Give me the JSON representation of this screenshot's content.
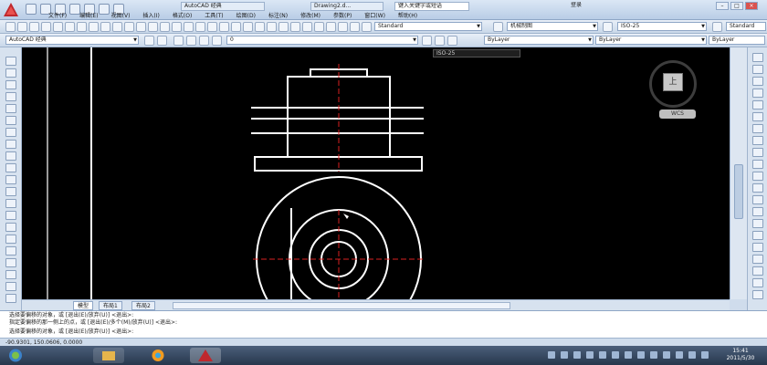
{
  "titlebar": {
    "workspace": "AutoCAD 经典",
    "document": "Drawing2.d...",
    "search_placeholder": "键入关键字或短语",
    "login": "登录"
  },
  "menu": [
    "文件(F)",
    "编辑(E)",
    "视图(V)",
    "插入(I)",
    "格式(O)",
    "工具(T)",
    "绘图(D)",
    "标注(N)",
    "修改(M)",
    "参数(P)",
    "窗口(W)",
    "帮助(H)"
  ],
  "toolbar2": {
    "text_style": "Standard",
    "dim_style_label": "机械制图",
    "dim_style": "ISO-25",
    "table_style": "Standard"
  },
  "toolbar3": {
    "workspace": "AutoCAD 经典",
    "layer": "ByLayer",
    "linetype": "ByLayer",
    "lineweight": "ByLayer",
    "bylayer_prefix": "ByLayer",
    "layer_num": "0",
    "dim_style_small": "ISO-25"
  },
  "viewcube": {
    "label": "上",
    "wcs": "WCS"
  },
  "tabs": [
    "模型",
    "布局1",
    "布局2"
  ],
  "command_lines": [
    "选择要偏移的对象，或 [退出(E)/放弃(U)] <退出>:",
    "指定要偏移的那一侧上的点，或 [退出(E)/多个(M)/放弃(U)] <退出>:",
    "选择要偏移的对象，或 [退出(E)/放弃(U)] <退出>:"
  ],
  "coordinates": "-90.9301, 150.0606, 0.0000",
  "clock": {
    "time": "15:41",
    "date": "2011/5/30"
  },
  "colors": {
    "canvas": "#000000",
    "drawing_lines": "#ffffff",
    "center_lines": "#d81f1f",
    "taskbar": "#2d3d55"
  },
  "icons": [
    "autocad-app-icon",
    "explorer-icon",
    "media-player-icon",
    "autocad-taskbar-icon"
  ]
}
